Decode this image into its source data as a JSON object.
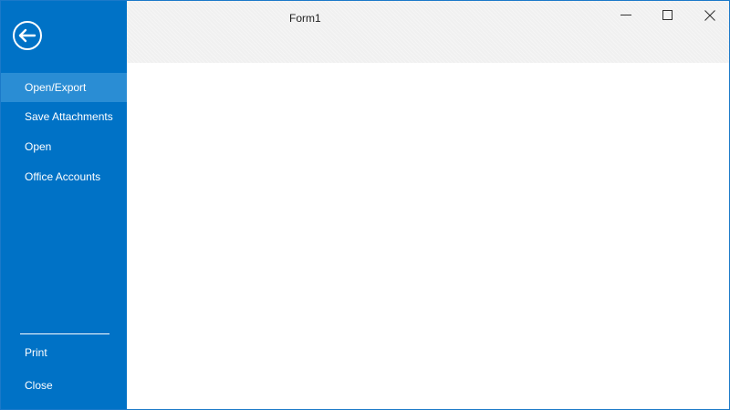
{
  "window": {
    "title": "Form1"
  },
  "sidebar": {
    "back_icon": "back-arrow-circle-icon",
    "items": [
      {
        "label": "Open/Export",
        "selected": true
      },
      {
        "label": "Save Attachments",
        "selected": false
      },
      {
        "label": "Open",
        "selected": false
      },
      {
        "label": "Office Accounts",
        "selected": false
      }
    ],
    "bottom_items": [
      {
        "label": "Print"
      },
      {
        "label": "Close"
      }
    ]
  },
  "caption_buttons": {
    "minimize_icon": "minimize-icon",
    "maximize_icon": "maximize-icon",
    "close_icon": "close-icon"
  },
  "colors": {
    "sidebar_background": "#0072c6",
    "selected_item_background": "#2a8dd4",
    "titlebar_background": "#f0f0f0",
    "window_border": "#1b79c9"
  }
}
